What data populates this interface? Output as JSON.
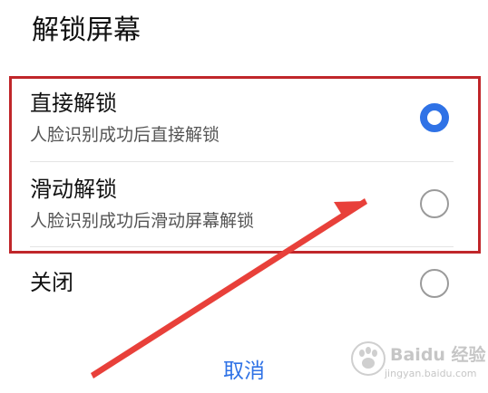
{
  "dialog": {
    "title": "解锁屏幕",
    "options": [
      {
        "label": "直接解锁",
        "subtitle": "人脸识别成功后直接解锁",
        "selected": true
      },
      {
        "label": "滑动解锁",
        "subtitle": "人脸识别成功后滑动屏幕解锁",
        "selected": false
      },
      {
        "label": "关闭",
        "selected": false
      }
    ],
    "cancel_label": "取消"
  },
  "colors": {
    "accent": "#2f72e6",
    "annotation": "#c0262a",
    "arrow": "#e8403a"
  },
  "watermark": {
    "brand": "Baidu 经验",
    "url": "jingyan.baidu.com"
  }
}
